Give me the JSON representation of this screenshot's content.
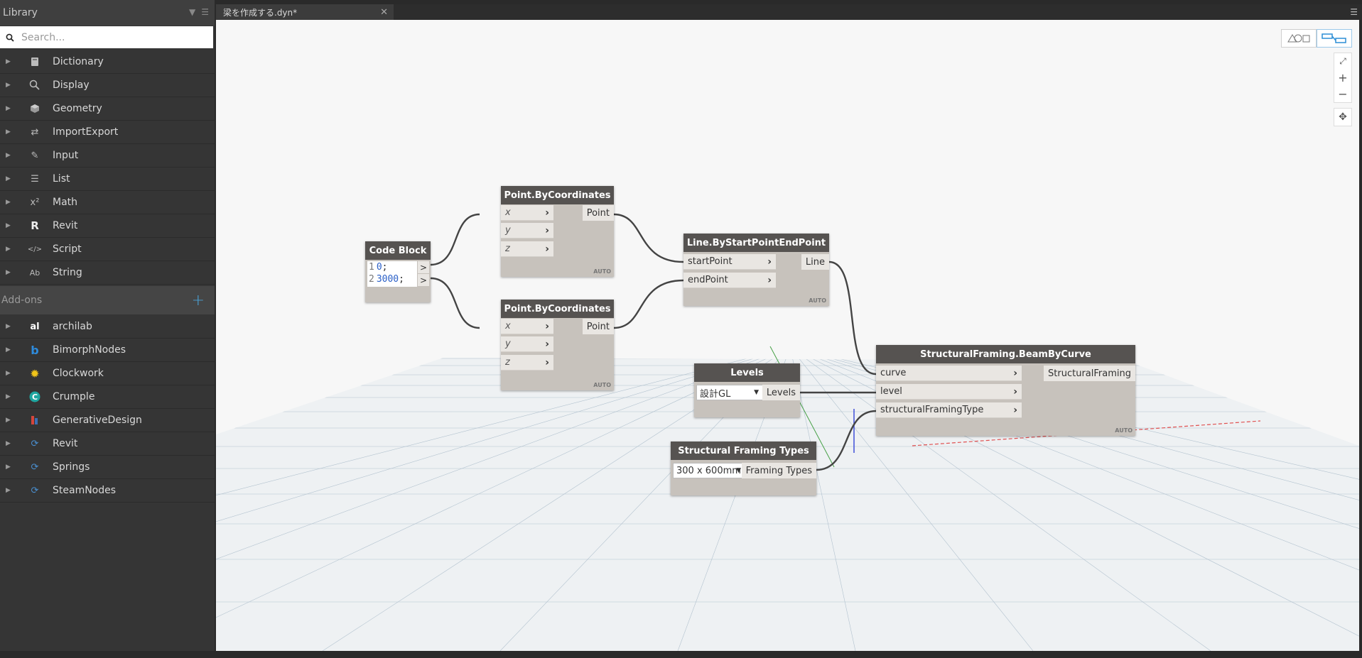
{
  "library": {
    "title": "Library",
    "search_placeholder": "Search...",
    "categories": [
      {
        "label": "Dictionary"
      },
      {
        "label": "Display"
      },
      {
        "label": "Geometry"
      },
      {
        "label": "ImportExport"
      },
      {
        "label": "Input"
      },
      {
        "label": "List"
      },
      {
        "label": "Math"
      },
      {
        "label": "Revit"
      },
      {
        "label": "Script"
      },
      {
        "label": "String"
      }
    ],
    "addons_title": "Add-ons",
    "addons": [
      {
        "label": "archilab"
      },
      {
        "label": "BimorphNodes"
      },
      {
        "label": "Clockwork"
      },
      {
        "label": "Crumple"
      },
      {
        "label": "GenerativeDesign"
      },
      {
        "label": "Revit"
      },
      {
        "label": "Springs"
      },
      {
        "label": "SteamNodes"
      }
    ]
  },
  "tab": {
    "label": "梁を作成する.dyn*"
  },
  "nodes": {
    "code_block": {
      "title": "Code Block",
      "line1_num": "1",
      "line1_val": "0",
      "line2_num": "2",
      "line2_val": "3000",
      "semi": ";",
      "out": ">"
    },
    "point1": {
      "title": "Point.ByCoordinates",
      "inputs": [
        "x",
        "y",
        "z"
      ],
      "output": "Point",
      "lacing": "AUTO"
    },
    "point2": {
      "title": "Point.ByCoordinates",
      "inputs": [
        "x",
        "y",
        "z"
      ],
      "output": "Point",
      "lacing": "AUTO"
    },
    "line": {
      "title": "Line.ByStartPointEndPoint",
      "inputs": [
        "startPoint",
        "endPoint"
      ],
      "output": "Line",
      "lacing": "AUTO"
    },
    "levels": {
      "title": "Levels",
      "selected": "設計GL",
      "output": "Levels"
    },
    "framing_types": {
      "title": "Structural Framing Types",
      "selected": "300 x 600mm",
      "output": "Framing Types"
    },
    "beam": {
      "title": "StructuralFraming.BeamByCurve",
      "inputs": [
        "curve",
        "level",
        "structuralFramingType"
      ],
      "output": "StructuralFraming",
      "lacing": "AUTO"
    }
  }
}
